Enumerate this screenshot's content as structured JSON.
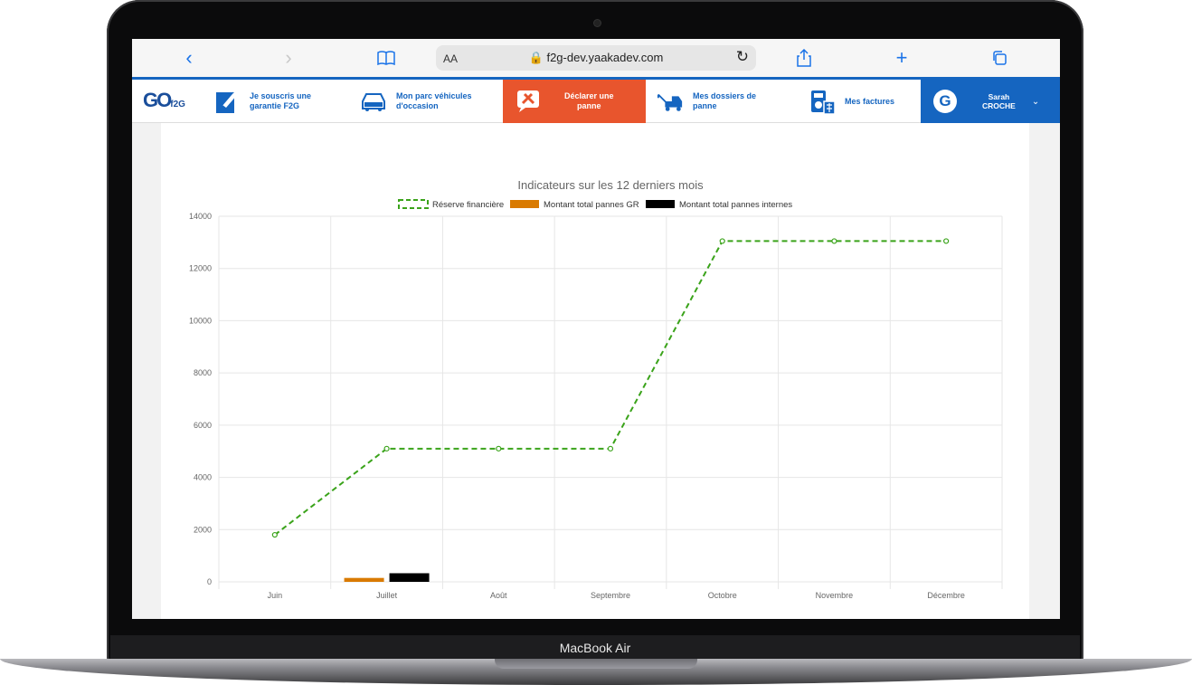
{
  "device": {
    "brand_label": "MacBook Air"
  },
  "browser": {
    "text_size_label": "AA",
    "url": "f2g-dev.yaakadev.com"
  },
  "nav": {
    "logo_text": "GO",
    "logo_sub": "f2G",
    "items": [
      {
        "label": "Je souscris une\ngarantie F2G",
        "icon": "document-pen-icon"
      },
      {
        "label": "Mon parc véhicules\nd'occasion",
        "icon": "car-icon"
      },
      {
        "label": "Déclarer une\npanne",
        "icon": "tools-icon",
        "active": true
      },
      {
        "label": "Mes dossiers de\npanne",
        "icon": "tow-truck-icon"
      },
      {
        "label": "Mes factures",
        "icon": "calculator-icon"
      }
    ],
    "user": {
      "first_name": "Sarah",
      "last_name": "CROCHE",
      "avatar_letter": "G"
    }
  },
  "colors": {
    "brand_blue": "#1565c0",
    "active_orange": "#e8552d",
    "series_reserve": "#3aa31a",
    "series_gr": "#d97a00",
    "series_internes": "#000000"
  },
  "chart_data": {
    "type": "line",
    "title": "Indicateurs sur les 12 derniers mois",
    "categories": [
      "Juin",
      "Juillet",
      "Août",
      "Septembre",
      "Octobre",
      "Novembre",
      "Décembre"
    ],
    "ylim": [
      0,
      14000
    ],
    "yticks": [
      "0",
      "2000",
      "4000",
      "6000",
      "8000",
      "10000",
      "12000",
      "14000"
    ],
    "grid": true,
    "legend_position": "top",
    "series": [
      {
        "name": "Réserve financière",
        "type": "line",
        "style": "dashed",
        "values": [
          1800,
          5100,
          5100,
          5100,
          13050,
          13050,
          13050
        ]
      },
      {
        "name": "Montant total pannes GR",
        "type": "bar",
        "values": [
          0,
          150,
          0,
          0,
          0,
          0,
          0
        ]
      },
      {
        "name": "Montant total pannes internes",
        "type": "bar",
        "values": [
          0,
          330,
          0,
          0,
          0,
          0,
          0
        ]
      }
    ]
  }
}
